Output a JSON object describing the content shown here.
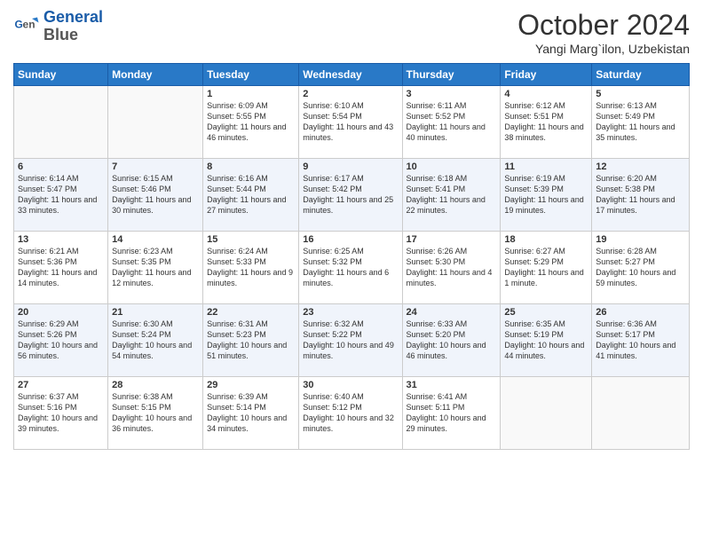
{
  "logo": {
    "line1": "General",
    "line2": "Blue"
  },
  "title": "October 2024",
  "location": "Yangi Marg`ilon, Uzbekistan",
  "days_of_week": [
    "Sunday",
    "Monday",
    "Tuesday",
    "Wednesday",
    "Thursday",
    "Friday",
    "Saturday"
  ],
  "weeks": [
    [
      {
        "day": "",
        "info": ""
      },
      {
        "day": "",
        "info": ""
      },
      {
        "day": "1",
        "info": "Sunrise: 6:09 AM\nSunset: 5:55 PM\nDaylight: 11 hours and 46 minutes."
      },
      {
        "day": "2",
        "info": "Sunrise: 6:10 AM\nSunset: 5:54 PM\nDaylight: 11 hours and 43 minutes."
      },
      {
        "day": "3",
        "info": "Sunrise: 6:11 AM\nSunset: 5:52 PM\nDaylight: 11 hours and 40 minutes."
      },
      {
        "day": "4",
        "info": "Sunrise: 6:12 AM\nSunset: 5:51 PM\nDaylight: 11 hours and 38 minutes."
      },
      {
        "day": "5",
        "info": "Sunrise: 6:13 AM\nSunset: 5:49 PM\nDaylight: 11 hours and 35 minutes."
      }
    ],
    [
      {
        "day": "6",
        "info": "Sunrise: 6:14 AM\nSunset: 5:47 PM\nDaylight: 11 hours and 33 minutes."
      },
      {
        "day": "7",
        "info": "Sunrise: 6:15 AM\nSunset: 5:46 PM\nDaylight: 11 hours and 30 minutes."
      },
      {
        "day": "8",
        "info": "Sunrise: 6:16 AM\nSunset: 5:44 PM\nDaylight: 11 hours and 27 minutes."
      },
      {
        "day": "9",
        "info": "Sunrise: 6:17 AM\nSunset: 5:42 PM\nDaylight: 11 hours and 25 minutes."
      },
      {
        "day": "10",
        "info": "Sunrise: 6:18 AM\nSunset: 5:41 PM\nDaylight: 11 hours and 22 minutes."
      },
      {
        "day": "11",
        "info": "Sunrise: 6:19 AM\nSunset: 5:39 PM\nDaylight: 11 hours and 19 minutes."
      },
      {
        "day": "12",
        "info": "Sunrise: 6:20 AM\nSunset: 5:38 PM\nDaylight: 11 hours and 17 minutes."
      }
    ],
    [
      {
        "day": "13",
        "info": "Sunrise: 6:21 AM\nSunset: 5:36 PM\nDaylight: 11 hours and 14 minutes."
      },
      {
        "day": "14",
        "info": "Sunrise: 6:23 AM\nSunset: 5:35 PM\nDaylight: 11 hours and 12 minutes."
      },
      {
        "day": "15",
        "info": "Sunrise: 6:24 AM\nSunset: 5:33 PM\nDaylight: 11 hours and 9 minutes."
      },
      {
        "day": "16",
        "info": "Sunrise: 6:25 AM\nSunset: 5:32 PM\nDaylight: 11 hours and 6 minutes."
      },
      {
        "day": "17",
        "info": "Sunrise: 6:26 AM\nSunset: 5:30 PM\nDaylight: 11 hours and 4 minutes."
      },
      {
        "day": "18",
        "info": "Sunrise: 6:27 AM\nSunset: 5:29 PM\nDaylight: 11 hours and 1 minute."
      },
      {
        "day": "19",
        "info": "Sunrise: 6:28 AM\nSunset: 5:27 PM\nDaylight: 10 hours and 59 minutes."
      }
    ],
    [
      {
        "day": "20",
        "info": "Sunrise: 6:29 AM\nSunset: 5:26 PM\nDaylight: 10 hours and 56 minutes."
      },
      {
        "day": "21",
        "info": "Sunrise: 6:30 AM\nSunset: 5:24 PM\nDaylight: 10 hours and 54 minutes."
      },
      {
        "day": "22",
        "info": "Sunrise: 6:31 AM\nSunset: 5:23 PM\nDaylight: 10 hours and 51 minutes."
      },
      {
        "day": "23",
        "info": "Sunrise: 6:32 AM\nSunset: 5:22 PM\nDaylight: 10 hours and 49 minutes."
      },
      {
        "day": "24",
        "info": "Sunrise: 6:33 AM\nSunset: 5:20 PM\nDaylight: 10 hours and 46 minutes."
      },
      {
        "day": "25",
        "info": "Sunrise: 6:35 AM\nSunset: 5:19 PM\nDaylight: 10 hours and 44 minutes."
      },
      {
        "day": "26",
        "info": "Sunrise: 6:36 AM\nSunset: 5:17 PM\nDaylight: 10 hours and 41 minutes."
      }
    ],
    [
      {
        "day": "27",
        "info": "Sunrise: 6:37 AM\nSunset: 5:16 PM\nDaylight: 10 hours and 39 minutes."
      },
      {
        "day": "28",
        "info": "Sunrise: 6:38 AM\nSunset: 5:15 PM\nDaylight: 10 hours and 36 minutes."
      },
      {
        "day": "29",
        "info": "Sunrise: 6:39 AM\nSunset: 5:14 PM\nDaylight: 10 hours and 34 minutes."
      },
      {
        "day": "30",
        "info": "Sunrise: 6:40 AM\nSunset: 5:12 PM\nDaylight: 10 hours and 32 minutes."
      },
      {
        "day": "31",
        "info": "Sunrise: 6:41 AM\nSunset: 5:11 PM\nDaylight: 10 hours and 29 minutes."
      },
      {
        "day": "",
        "info": ""
      },
      {
        "day": "",
        "info": ""
      }
    ]
  ]
}
